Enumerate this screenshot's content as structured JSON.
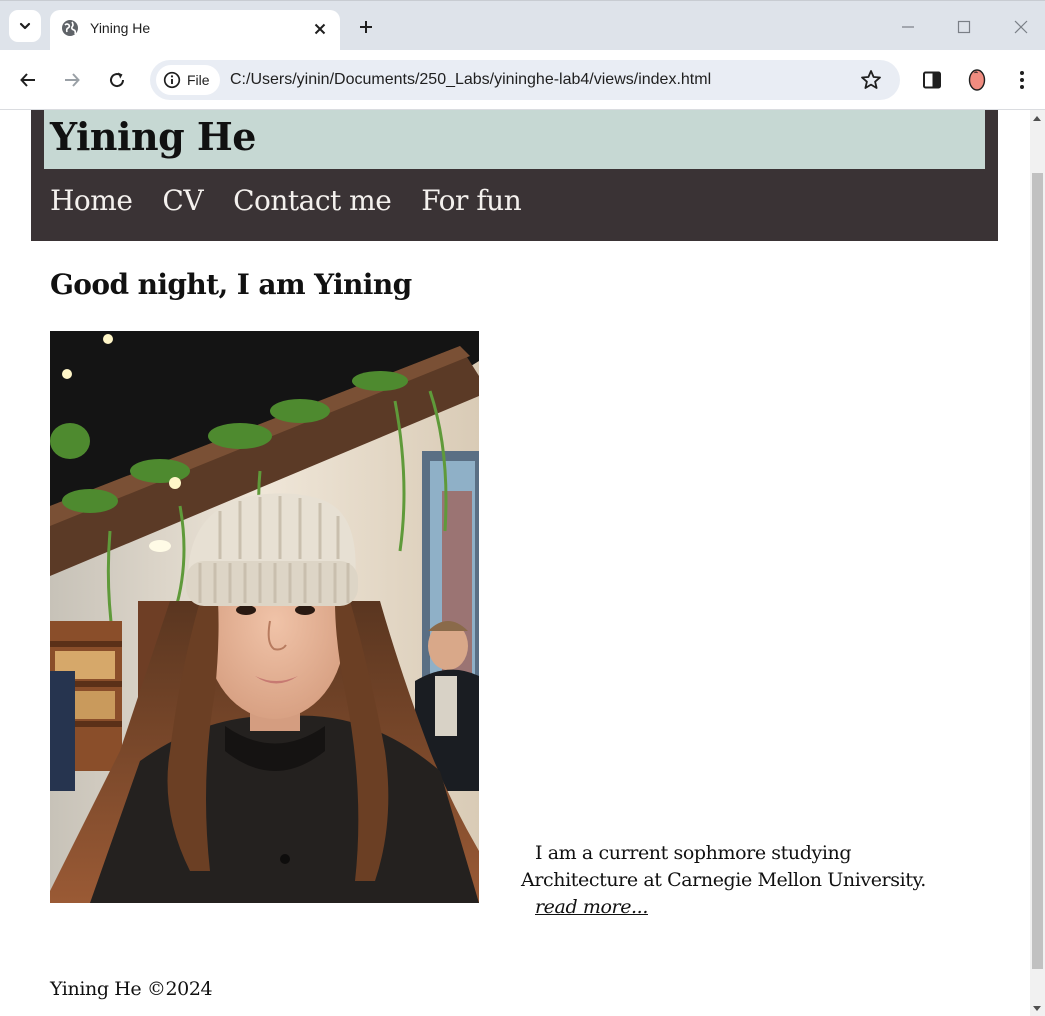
{
  "browser": {
    "tab_title": "Yining He",
    "site_chip_label": "File",
    "url": "C:/Users/yinin/Documents/250_Labs/yininghe-lab4/views/index.html"
  },
  "site": {
    "title": "Yining He",
    "nav": [
      "Home",
      "CV",
      "Contact me",
      "For fun"
    ],
    "greeting": "Good night, I am Yining",
    "bio": "I am a current sophmore studying Architecture at Carnegie Mellon University.",
    "read_more": "read more...",
    "footer": "Yining He ©2024"
  },
  "colors": {
    "header_dark": "#3a3335",
    "title_bar": "#c6d8d3",
    "nav_text": "#f4f1ee"
  }
}
